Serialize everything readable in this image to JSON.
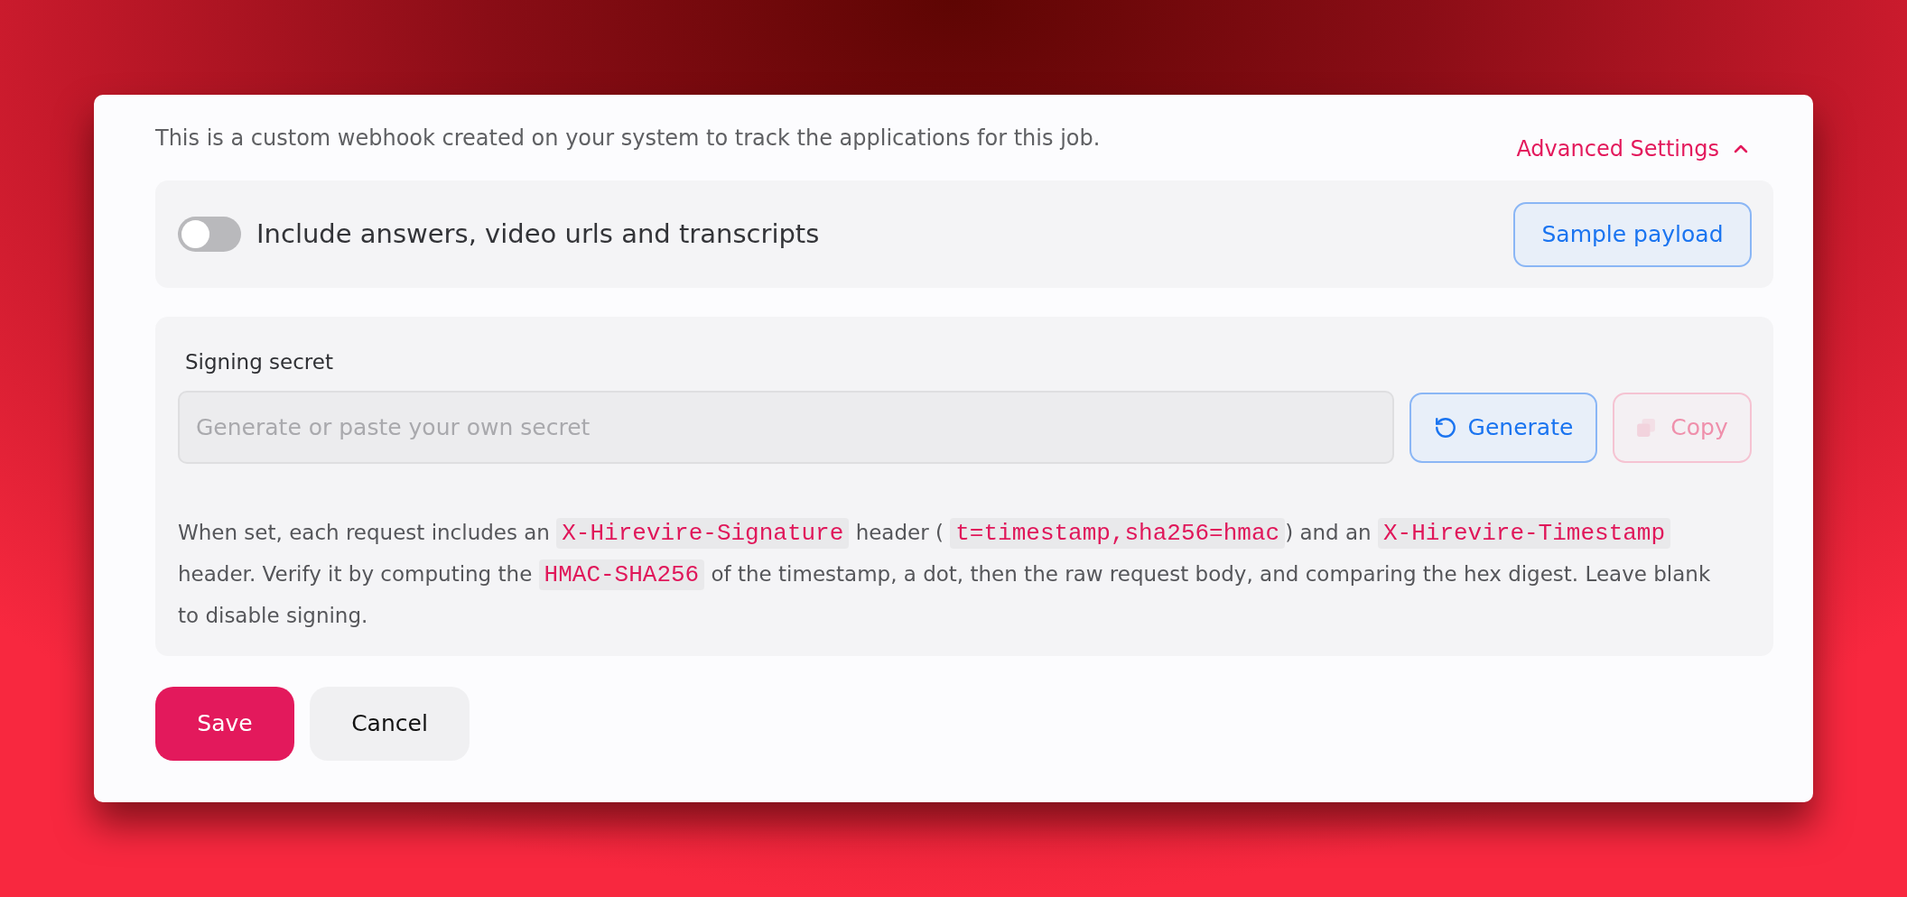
{
  "intro": {
    "text": "This is a custom webhook created on your system to track the applications for this job."
  },
  "advanced_settings": {
    "label": "Advanced Settings",
    "expanded": true
  },
  "include_toggle": {
    "label": "Include answers, video urls and transcripts",
    "on": false
  },
  "sample_payload_button": {
    "label": "Sample payload"
  },
  "signing_secret": {
    "label": "Signing secret",
    "input": {
      "placeholder": "Generate or paste your own secret"
    },
    "buttons": [
      {
        "kind": "generate",
        "label": "Generate",
        "disabled": false
      },
      {
        "kind": "copy",
        "label": "Copy",
        "disabled": true
      }
    ],
    "help": [
      {
        "kind": "text",
        "text": "When set, each request includes an "
      },
      {
        "kind": "code",
        "text": "X-Hirevire-Signature"
      },
      {
        "kind": "text",
        "text": " header ( "
      },
      {
        "kind": "code",
        "text": "t=timestamp,sha256=hmac"
      },
      {
        "kind": "text",
        "text": ") and an "
      },
      {
        "kind": "code",
        "text": "X-Hirevire-Timestamp"
      },
      {
        "kind": "text",
        "text": " header. Verify it by computing the "
      },
      {
        "kind": "code",
        "text": "HMAC-SHA256"
      },
      {
        "kind": "text",
        "text": " of the timestamp, a dot, then the raw request body, and comparing the hex digest. Leave blank to disable signing."
      }
    ]
  },
  "actions": [
    {
      "kind": "primary",
      "label": "Save"
    },
    {
      "kind": "secondary",
      "label": "Cancel"
    }
  ]
}
